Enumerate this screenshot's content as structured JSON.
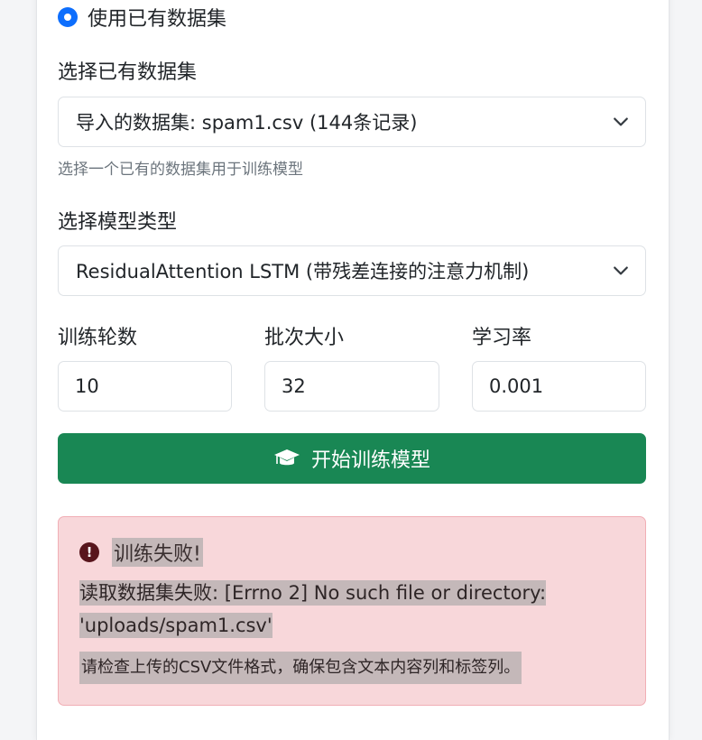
{
  "dataset_source": {
    "radio_label": "使用已有数据集",
    "selected": true
  },
  "dataset_select": {
    "label": "选择已有数据集",
    "value": "导入的数据集: spam1.csv (144条记录)",
    "help": "选择一个已有的数据集用于训练模型"
  },
  "model_select": {
    "label": "选择模型类型",
    "value": "ResidualAttention LSTM (带残差连接的注意力机制)"
  },
  "params": {
    "epochs": {
      "label": "训练轮数",
      "value": "10"
    },
    "batch_size": {
      "label": "批次大小",
      "value": "32"
    },
    "learning_rate": {
      "label": "学习率",
      "value": "0.001"
    }
  },
  "train_button": {
    "label": "开始训练模型",
    "icon": "graduation-cap-icon"
  },
  "alert": {
    "icon": "exclamation-circle-icon",
    "title": "训练失败!",
    "message": "读取数据集失败: [Errno 2] No such file or directory: 'uploads/spam1.csv'",
    "hint": "请检查上传的CSV文件格式，确保包含文本内容列和标签列。"
  },
  "colors": {
    "primary": "#0d6efd",
    "success": "#198754",
    "danger_bg": "#f8d7da",
    "danger_border": "#f1aeb5"
  }
}
